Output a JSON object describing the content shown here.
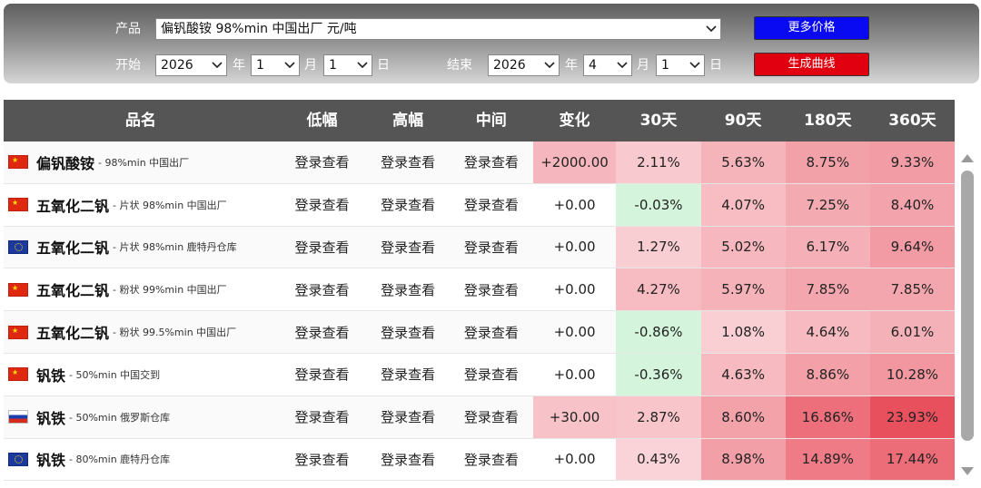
{
  "filters": {
    "product_label": "产品",
    "product_value": "偏钒酸铵 98%min 中国出厂 元/吨",
    "start_label": "开始",
    "end_label": "结束",
    "start": {
      "year": "2026",
      "year_unit": "年",
      "month": "1",
      "month_unit": "月",
      "day": "1",
      "day_unit": "日"
    },
    "end": {
      "year": "2026",
      "year_unit": "年",
      "month": "4",
      "month_unit": "月",
      "day": "1",
      "day_unit": "日"
    },
    "more_prices_button": "更多价格",
    "generate_curve_button": "生成曲线",
    "colors": {
      "more_button": "#0a0af2",
      "curve_button": "#e0000f"
    }
  },
  "table": {
    "headers": [
      "品名",
      "低幅",
      "高幅",
      "中间",
      "变化",
      "30天",
      "90天",
      "180天",
      "360天"
    ],
    "rows": [
      {
        "flag": "cn",
        "name": "偏钒酸铵",
        "desc": "- 98%min 中国出厂",
        "low": "登录查看",
        "high": "登录查看",
        "mid": "登录查看",
        "change": "+2000.00",
        "d30": "2.11%",
        "d90": "5.63%",
        "d180": "8.75%",
        "d360": "9.33%"
      },
      {
        "flag": "cn",
        "name": "五氧化二钒",
        "desc": "- 片状 98%min 中国出厂",
        "low": "登录查看",
        "high": "登录查看",
        "mid": "登录查看",
        "change": "+0.00",
        "d30": "-0.03%",
        "d90": "4.07%",
        "d180": "7.25%",
        "d360": "8.40%"
      },
      {
        "flag": "eu",
        "name": "五氧化二钒",
        "desc": "- 片状 98%min 鹿特丹仓库",
        "low": "登录查看",
        "high": "登录查看",
        "mid": "登录查看",
        "change": "+0.00",
        "d30": "1.27%",
        "d90": "5.02%",
        "d180": "6.17%",
        "d360": "9.64%"
      },
      {
        "flag": "cn",
        "name": "五氧化二钒",
        "desc": "- 粉状 99%min 中国出厂",
        "low": "登录查看",
        "high": "登录查看",
        "mid": "登录查看",
        "change": "+0.00",
        "d30": "4.27%",
        "d90": "5.97%",
        "d180": "7.85%",
        "d360": "7.85%"
      },
      {
        "flag": "cn",
        "name": "五氧化二钒",
        "desc": "- 粉状 99.5%min 中国出厂",
        "low": "登录查看",
        "high": "登录查看",
        "mid": "登录查看",
        "change": "+0.00",
        "d30": "-0.86%",
        "d90": "1.08%",
        "d180": "4.64%",
        "d360": "6.01%"
      },
      {
        "flag": "cn",
        "name": "钒铁",
        "desc": "- 50%min 中国交到",
        "low": "登录查看",
        "high": "登录查看",
        "mid": "登录查看",
        "change": "+0.00",
        "d30": "-0.36%",
        "d90": "4.63%",
        "d180": "8.86%",
        "d360": "10.28%"
      },
      {
        "flag": "ru",
        "name": "钒铁",
        "desc": "- 50%min 俄罗斯仓库",
        "low": "登录查看",
        "high": "登录查看",
        "mid": "登录查看",
        "change": "+30.00",
        "d30": "2.87%",
        "d90": "8.60%",
        "d180": "16.86%",
        "d360": "23.93%"
      },
      {
        "flag": "eu",
        "name": "钒铁",
        "desc": "- 80%min 鹿特丹仓库",
        "low": "登录查看",
        "high": "登录查看",
        "mid": "登录查看",
        "change": "+0.00",
        "d30": "0.43%",
        "d90": "8.98%",
        "d180": "14.89%",
        "d360": "17.44%"
      }
    ]
  },
  "colors": {
    "header_bg": "#555555",
    "positive_heat_max": "#e8505e",
    "negative_heat": "#d4f5dc",
    "change_up_bg": "#f5b7bd"
  }
}
